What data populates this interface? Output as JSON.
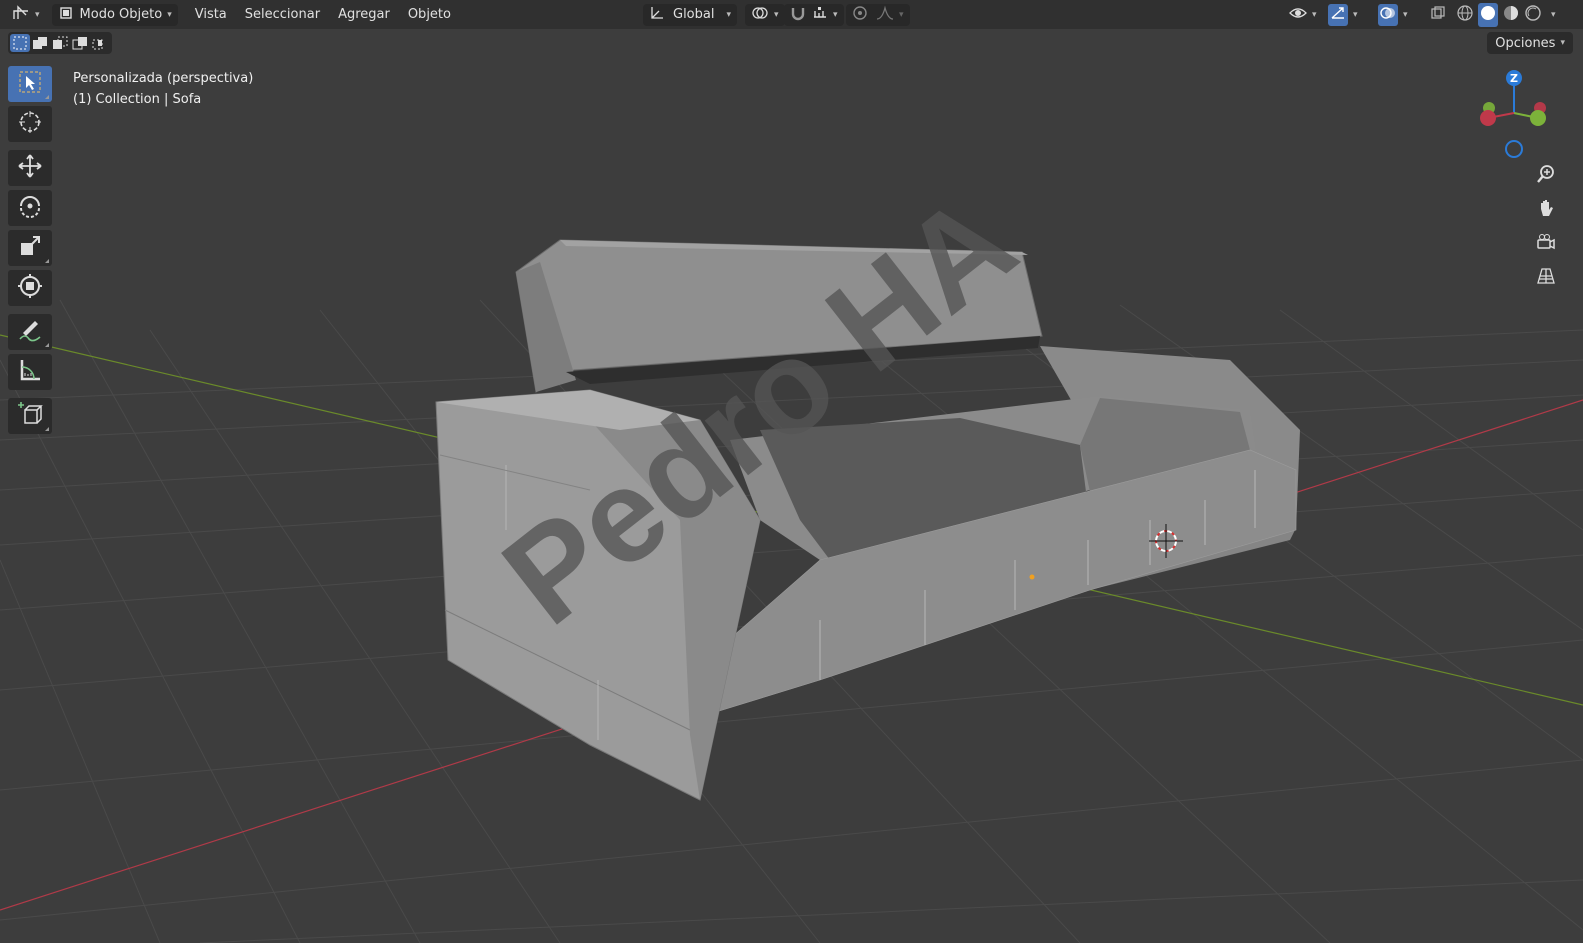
{
  "header": {
    "mode_label": "Modo Objeto",
    "menus": [
      "Vista",
      "Seleccionar",
      "Agregar",
      "Objeto"
    ],
    "orientation_label": "Global",
    "icons": {
      "editor_type": "editor-type-icon",
      "mode": "object-mode-icon",
      "transform": "transform-orientation-icon",
      "pivot": "pivot-point-icon",
      "snap": "snap-magnet-icon",
      "snap_target": "snap-increment-icon",
      "proportional": "proportional-editing-icon",
      "falloff": "falloff-curve-icon",
      "visibility": "eye-icon",
      "gizmo": "gizmo-icon",
      "overlays": "overlays-icon",
      "xray": "xray-icon",
      "shading": [
        "wireframe-icon",
        "solid-icon",
        "material-preview-icon",
        "rendered-icon"
      ]
    }
  },
  "subheader": {
    "options_label": "Opciones",
    "select_modes": [
      "select-new-icon",
      "select-extend-icon",
      "select-subtract-icon",
      "select-invert-icon",
      "select-intersect-icon"
    ]
  },
  "tools": [
    {
      "name": "select-box-icon",
      "active": true
    },
    {
      "name": "cursor-icon"
    },
    {
      "name": "move-icon"
    },
    {
      "name": "rotate-icon"
    },
    {
      "name": "scale-icon"
    },
    {
      "name": "transform-icon"
    },
    {
      "name": "annotate-icon"
    },
    {
      "name": "measure-icon"
    },
    {
      "name": "add-cube-icon"
    }
  ],
  "viewport": {
    "view_name": "Personalizada (perspectiva)",
    "collection_line": "(1) Collection | Sofa",
    "watermark": "Pedro HA",
    "gizmo_axis_label": "Z",
    "colors": {
      "background": "#3d3d3d",
      "grid": "#4a4a4a",
      "x_axis": "#b03a48",
      "y_axis": "#6a8a2a",
      "active_blue": "#4772b3",
      "sofa": "#8c8c8c"
    }
  }
}
